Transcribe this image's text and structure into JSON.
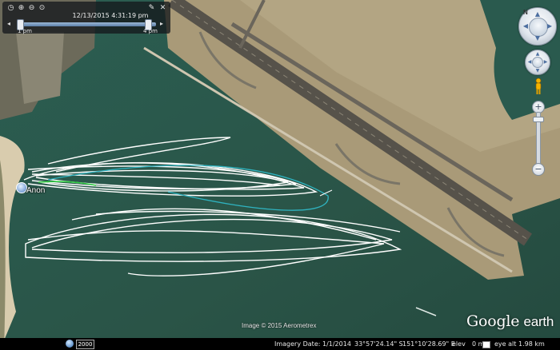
{
  "toolbar": {
    "icons": [
      "clock-icon",
      "zoom-in-icon",
      "zoom-out-icon",
      "fast-forward-icon"
    ],
    "settings_icon": "wrench-icon",
    "close_icon": "close-icon"
  },
  "time_slider": {
    "current_time": "12/13/2015   4:31:19 pm",
    "start_label": "1 pm",
    "end_label": "4 pm",
    "position": 0.96
  },
  "map": {
    "placemark_label": "Anon",
    "attribution": "Image © 2015 Aerometrex",
    "colors": {
      "water": "#2c5a4d",
      "land": "#a99a78",
      "runway": "#56524a",
      "track": "#ffffff",
      "track_alt": "#2fb3c0",
      "track_green": "#2ecc40"
    }
  },
  "logo": {
    "word1": "Google",
    "word2": "earth"
  },
  "status_bar": {
    "history_year": "2000",
    "imagery_date": "Imagery Date: 1/1/2014",
    "latitude": "33°57'24.14\" S",
    "longitude": "151°10'28.69\" E",
    "elev_label": "elev",
    "elev_value": "0 m",
    "eye_alt_label": "eye alt",
    "eye_alt_value": "1.98 km"
  },
  "nav": {
    "north_label": "N"
  }
}
